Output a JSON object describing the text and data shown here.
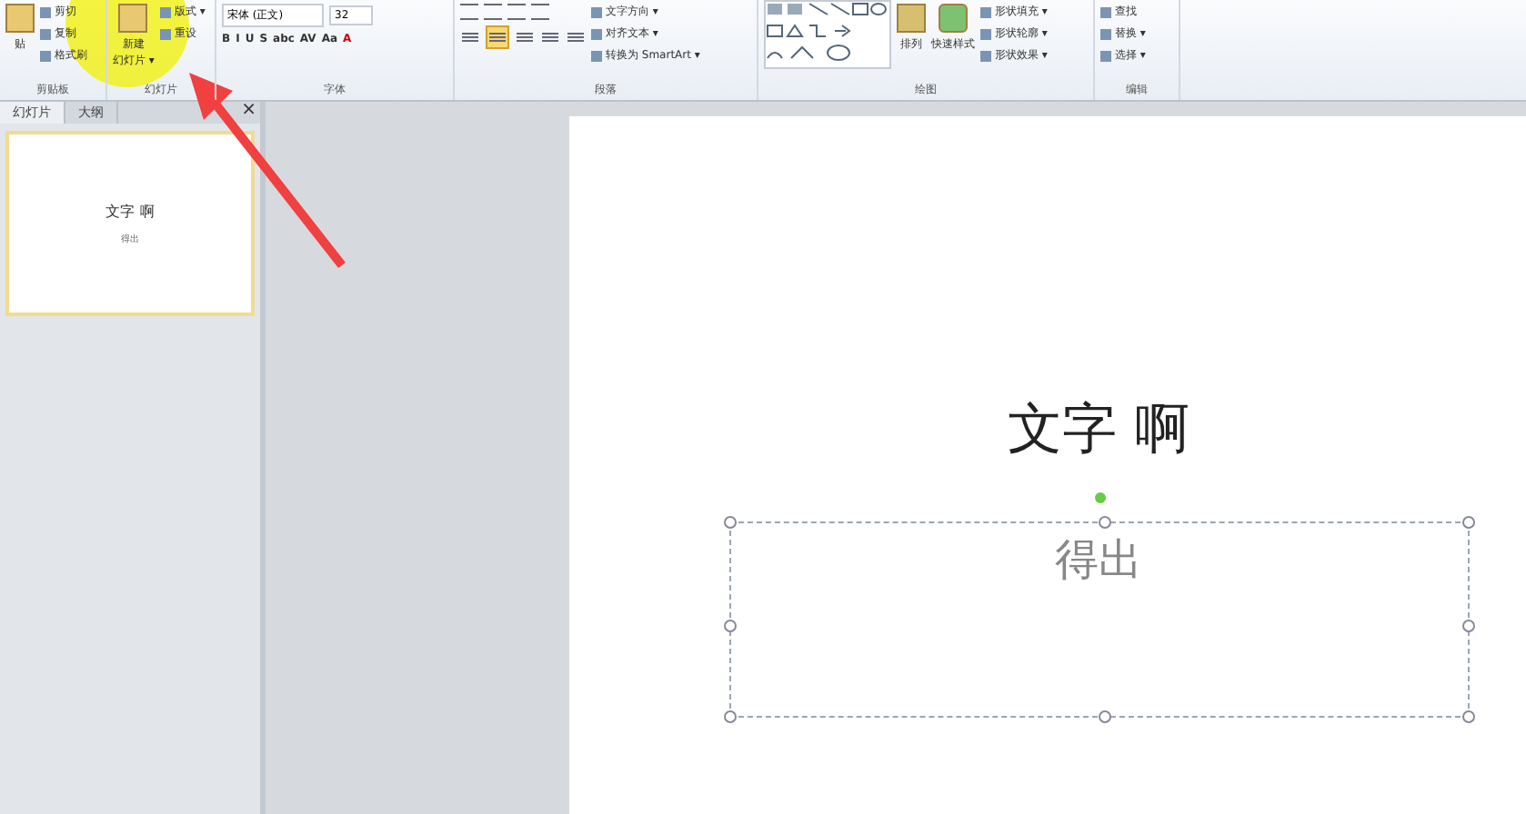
{
  "ribbon": {
    "groups": [
      {
        "kind": "clipboard",
        "label": "剪贴板",
        "big": "贴",
        "items": [
          "剪切",
          "复制",
          "格式刷"
        ]
      },
      {
        "kind": "slides",
        "label": "幻灯片",
        "big": "新建",
        "big_sub": "幻灯片 ▾",
        "items": [
          "版式 ▾",
          "重设"
        ]
      },
      {
        "kind": "font",
        "label": "字体",
        "font": "宋体 (正文)",
        "size": "32",
        "buttons": [
          "B",
          "I",
          "U",
          "S",
          "abc",
          "AV",
          "Aa",
          "A"
        ]
      },
      {
        "kind": "paragraph",
        "label": "段落",
        "align": [
          {
            "selected": false
          },
          {
            "selected": true
          },
          {
            "selected": false
          },
          {
            "selected": false
          },
          {
            "selected": false
          }
        ],
        "items": [
          "文字方向 ▾",
          "对齐文本 ▾",
          "转换为 SmartArt ▾"
        ]
      },
      {
        "kind": "drawing",
        "label": "绘图",
        "bigs": [
          "排列",
          "快速样式"
        ],
        "items": [
          "形状填充 ▾",
          "形状轮廓 ▾",
          "形状效果 ▾"
        ]
      },
      {
        "kind": "editing",
        "label": "编辑",
        "items": [
          "查找",
          "替换 ▾",
          "选择 ▾"
        ]
      }
    ]
  },
  "panel": {
    "tabs": [
      {
        "label": "幻灯片",
        "selected": true
      },
      {
        "label": "大纲",
        "selected": false
      }
    ],
    "close": "×",
    "thumbnails": [
      {
        "title": "文字 啊",
        "subtitle": "得出",
        "selected": true
      }
    ]
  },
  "slide": {
    "title": "文字 啊",
    "subtitle": "得出",
    "subtitle_selected": true
  }
}
